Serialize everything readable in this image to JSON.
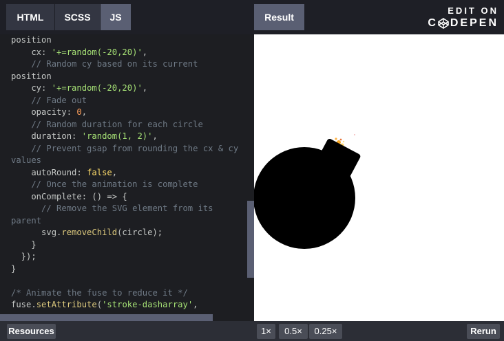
{
  "tabs": [
    {
      "label": "HTML",
      "active": false
    },
    {
      "label": "SCSS",
      "active": false
    },
    {
      "label": "JS",
      "active": true
    }
  ],
  "result_tab": {
    "label": "Result"
  },
  "edit_on": {
    "line1": "EDIT ON",
    "line2": "DEPEN",
    "logo_icon": "codepen-icon"
  },
  "code_lines": [
    [
      [
        "",
        "position"
      ]
    ],
    [
      [
        "",
        "    cx: "
      ],
      [
        "s",
        "'+=random(-20,20)'"
      ],
      [
        "",
        ","
      ]
    ],
    [
      [
        "c",
        "    // Random cy based on its current"
      ]
    ],
    [
      [
        "",
        "position"
      ]
    ],
    [
      [
        "",
        "    cy: "
      ],
      [
        "s",
        "'+=random(-20,20)'"
      ],
      [
        "",
        ","
      ]
    ],
    [
      [
        "c",
        "    // Fade out"
      ]
    ],
    [
      [
        "",
        "    opacity: "
      ],
      [
        "n",
        "0"
      ],
      [
        "",
        ","
      ]
    ],
    [
      [
        "c",
        "    // Random duration for each circle"
      ]
    ],
    [
      [
        "",
        "    duration: "
      ],
      [
        "s",
        "'random(1, 2)'"
      ],
      [
        "",
        ","
      ]
    ],
    [
      [
        "c",
        "    // Prevent gsap from rounding the cx & cy"
      ]
    ],
    [
      [
        "c",
        "values"
      ]
    ],
    [
      [
        "",
        "    autoRound: "
      ],
      [
        "k",
        "false"
      ],
      [
        "",
        ","
      ]
    ],
    [
      [
        "c",
        "    // Once the animation is complete"
      ]
    ],
    [
      [
        "",
        "    onComplete: () => {"
      ]
    ],
    [
      [
        "c",
        "      // Remove the SVG element from its"
      ]
    ],
    [
      [
        "c",
        "parent"
      ]
    ],
    [
      [
        "",
        "      svg."
      ],
      [
        "f",
        "removeChild"
      ],
      [
        "",
        "(circle);"
      ]
    ],
    [
      [
        "",
        "    }"
      ]
    ],
    [
      [
        "",
        "  });"
      ]
    ],
    [
      [
        "",
        "}"
      ]
    ],
    [
      [
        "",
        ""
      ]
    ],
    [
      [
        "c",
        "/* Animate the fuse to reduce it */"
      ]
    ],
    [
      [
        "",
        "fuse."
      ],
      [
        "f",
        "setAttribute"
      ],
      [
        "",
        "("
      ],
      [
        "s",
        "'stroke-dasharray'"
      ],
      [
        "",
        ","
      ]
    ]
  ],
  "bottom": {
    "resources": "Resources",
    "zoom": [
      "1×",
      "0.5×",
      "0.25×"
    ],
    "rerun": "Rerun"
  },
  "colors": {
    "accent_tab": "#5a5f73",
    "bomb": "#000000",
    "spark": "#f5a623"
  }
}
